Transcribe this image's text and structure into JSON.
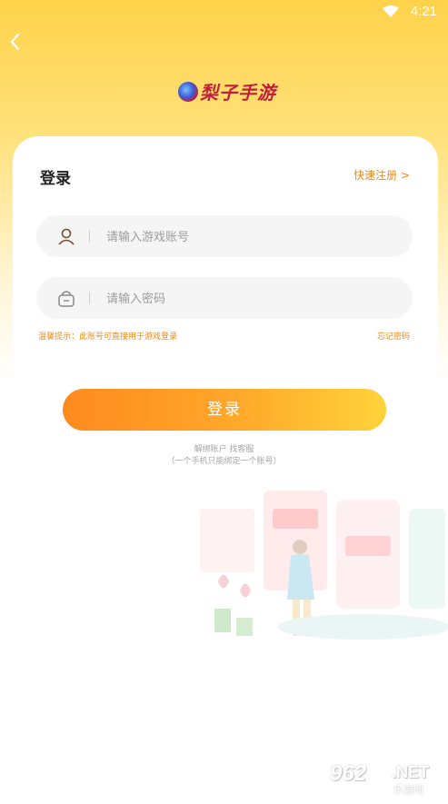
{
  "status_bar": {
    "time": "4:21",
    "wifi_icon": "wifi-icon"
  },
  "header": {
    "back_icon": "chevron-left-icon",
    "logo_text": "梨子手游"
  },
  "login_card": {
    "title": "登录",
    "register_link": "快速注册 >",
    "account_field": {
      "icon": "user-icon",
      "placeholder": "请输入游戏账号",
      "value": ""
    },
    "password_field": {
      "icon": "lock-icon",
      "placeholder": "请输入密码",
      "value": ""
    },
    "tip": "温馨提示：此账号可直接用于游戏登录",
    "forgot_password": "忘记密码"
  },
  "login_button": "登录",
  "unbind": {
    "link": "解绑账户 找客服",
    "note": "（一个手机只能绑定一个账号）"
  },
  "watermark": {
    "number": "962",
    "net": ".NET",
    "cn": "乐游网"
  },
  "colors": {
    "accent": "#f08a16",
    "brand": "#c0203a",
    "header_yellow": "#ffd24a"
  }
}
